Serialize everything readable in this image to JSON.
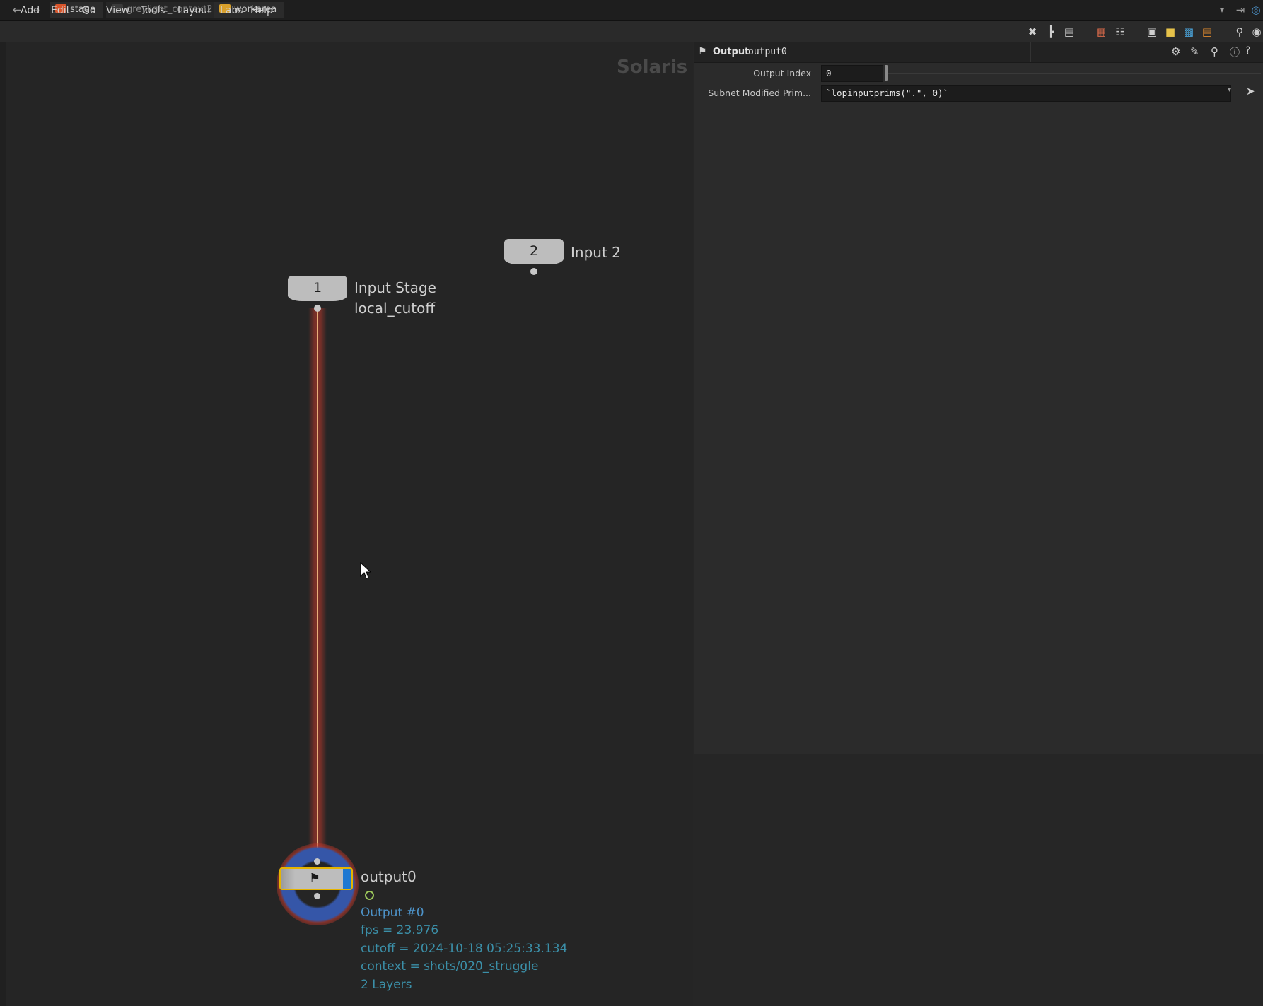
{
  "pathbar": {
    "crumbs": [
      "stage",
      "greylight_context2",
      "workarea"
    ]
  },
  "menu": {
    "items": [
      "Add",
      "Edit",
      "Go",
      "View",
      "Tools",
      "Layout",
      "Labs",
      "Help"
    ]
  },
  "network": {
    "context_label": "Solaris",
    "nodes": {
      "input1": {
        "number": "1",
        "label": "Input Stage",
        "sublabel": "local_cutoff"
      },
      "input2": {
        "number": "2",
        "label": "Input 2"
      },
      "output": {
        "name": "output0",
        "info": [
          "Output #0",
          "fps = 23.976",
          "cutoff = 2024-10-18 05:25:33.134",
          "context = shots/020_struggle",
          "2 Layers"
        ]
      }
    }
  },
  "params": {
    "node_type": "Output",
    "node_name": "output0",
    "output_index_label": "Output Index",
    "output_index_value": "0",
    "subnet_label": "Subnet Modified Prim...",
    "subnet_value": "`lopinputprims(\".\", 0)`"
  },
  "colors": {
    "wire": "#c0392b",
    "wire_core": "#e8b07a",
    "output_node_border": "#e6b400",
    "output_flag_blue": "#1e78d2",
    "info_text": "#3b8fa8"
  }
}
